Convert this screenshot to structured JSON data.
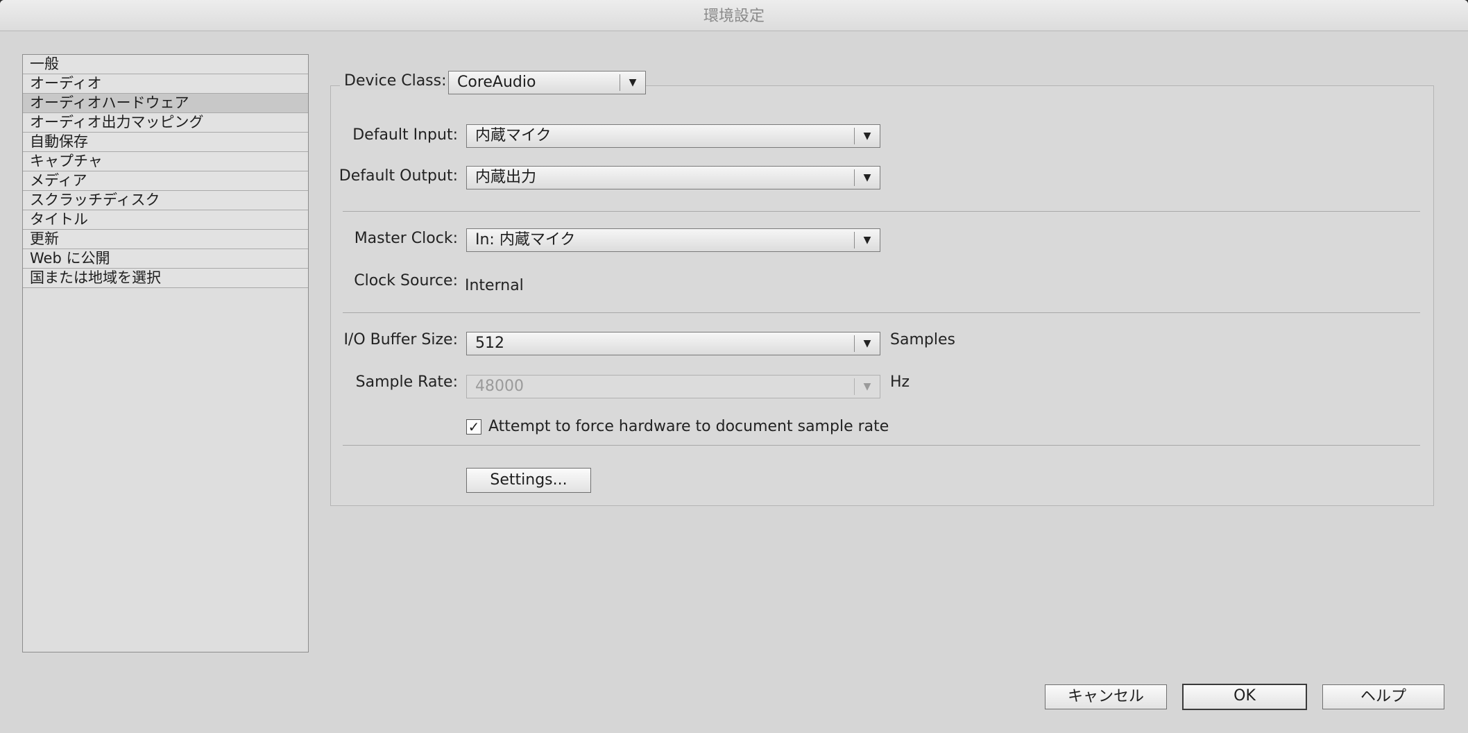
{
  "window": {
    "title": "環境設定"
  },
  "categories": [
    "一般",
    "オーディオ",
    "オーディオハードウェア",
    "オーディオ出力マッピング",
    "自動保存",
    "キャプチャ",
    "メディア",
    "スクラッチディスク",
    "タイトル",
    "更新",
    "Web に公開",
    "国または地域を選択"
  ],
  "selected_category_index": 2,
  "audio_hardware": {
    "device_class_label": "Device Class:",
    "device_class_value": "CoreAudio",
    "default_input_label": "Default Input:",
    "default_input_value": "内蔵マイク",
    "default_output_label": "Default Output:",
    "default_output_value": "内蔵出力",
    "master_clock_label": "Master Clock:",
    "master_clock_value": "In: 内蔵マイク",
    "clock_source_label": "Clock Source:",
    "clock_source_value": "Internal",
    "buffer_size_label": "I/O Buffer Size:",
    "buffer_size_value": "512",
    "buffer_size_unit": "Samples",
    "sample_rate_label": "Sample Rate:",
    "sample_rate_value": "48000",
    "sample_rate_unit": "Hz",
    "force_rate_label": "Attempt to force hardware to document sample rate",
    "force_rate_checked": true,
    "settings_button": "Settings..."
  },
  "dialog_buttons": {
    "cancel": "キャンセル",
    "ok": "OK",
    "help": "ヘルプ"
  },
  "icons": {
    "dropdown_arrow": "chevron-down-icon",
    "check": "checkmark-icon"
  }
}
